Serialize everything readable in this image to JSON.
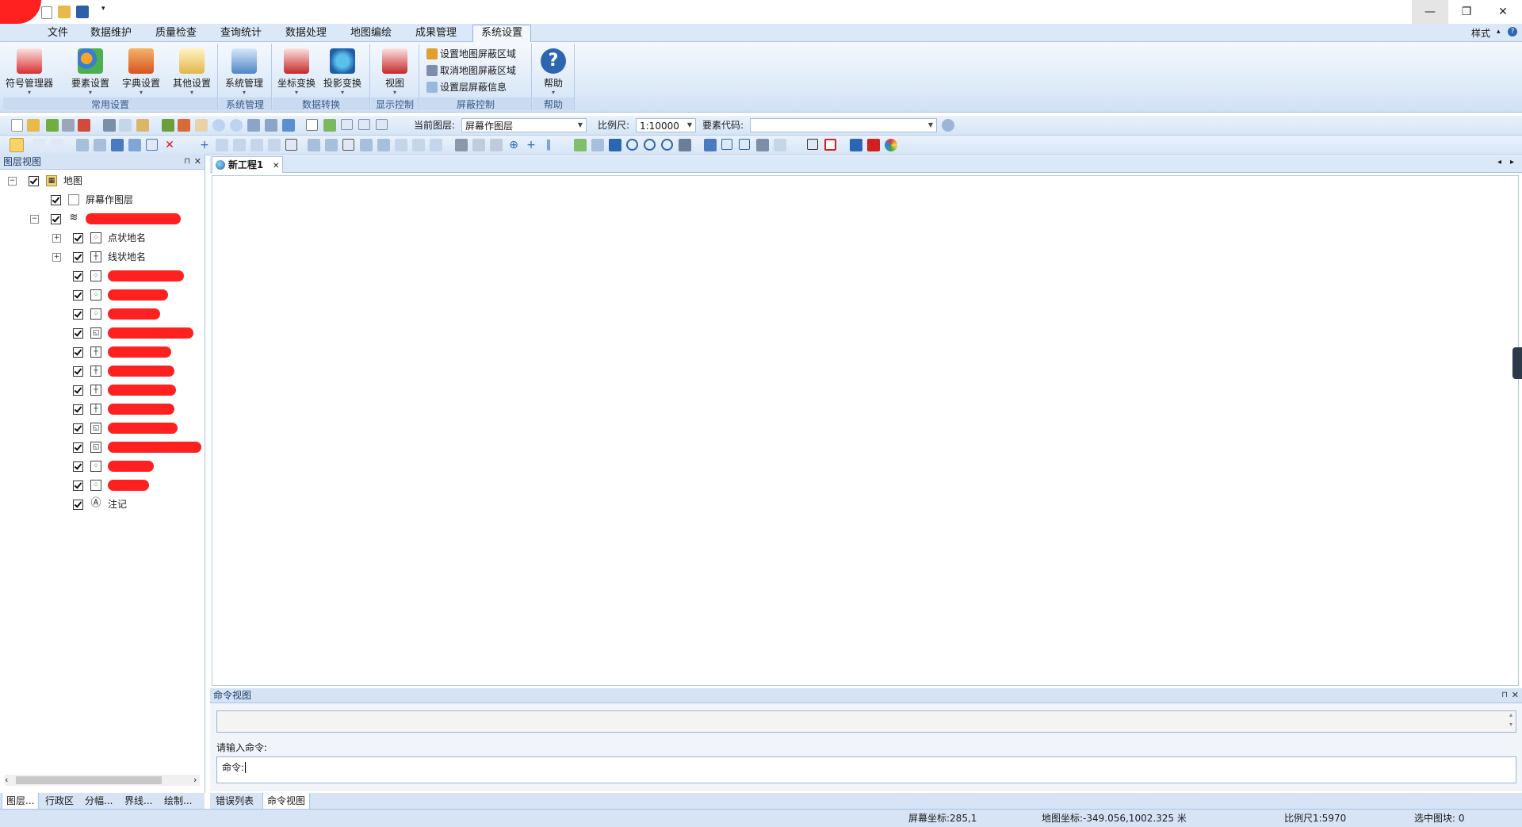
{
  "window": {
    "minimize": "—",
    "restore": "❐",
    "close": "✕"
  },
  "ribbon": {
    "tabs": [
      "文件",
      "数据维护",
      "质量检查",
      "查询统计",
      "数据处理",
      "地图编绘",
      "成果管理",
      "系统设置"
    ],
    "active_tab": "系统设置",
    "style_label": "样式",
    "groups": {
      "common": {
        "label": "常用设置",
        "buttons": [
          "符号管理器",
          "要素设置",
          "字典设置",
          "其他设置"
        ]
      },
      "system": {
        "label": "系统管理",
        "buttons": [
          "系统管理"
        ]
      },
      "convert": {
        "label": "数据转换",
        "buttons": [
          "坐标变换",
          "投影变换"
        ]
      },
      "display": {
        "label": "显示控制",
        "buttons": [
          "视图"
        ]
      },
      "mask": {
        "label": "屏蔽控制",
        "buttons": [
          "设置地图屏蔽区域",
          "取消地图屏蔽区域",
          "设置层屏蔽信息"
        ]
      },
      "help": {
        "label": "帮助",
        "buttons": [
          "帮助"
        ]
      }
    }
  },
  "toolbar1": {
    "current_layer_label": "当前图层:",
    "current_layer_value": "屏幕作图层",
    "scale_label": "比例尺:",
    "scale_value": "1:10000",
    "feature_code_label": "要素代码:",
    "feature_code_value": ""
  },
  "layer_panel": {
    "title": "图层视图",
    "tree": [
      {
        "label": "地图",
        "level": 0,
        "icon": "map"
      },
      {
        "label": "屏幕作图层",
        "level": 1,
        "icon": "page"
      },
      {
        "label": "",
        "level": 1,
        "icon": "layers",
        "redacted": true
      },
      {
        "label": "点状地名",
        "level": 2,
        "icon": "point"
      },
      {
        "label": "线状地名",
        "level": 2,
        "icon": "line"
      },
      {
        "label": "",
        "level": 2,
        "icon": "point",
        "redacted": true
      },
      {
        "label": "",
        "level": 2,
        "icon": "point",
        "redacted": true
      },
      {
        "label": "",
        "level": 2,
        "icon": "point",
        "redacted": true
      },
      {
        "label": "",
        "level": 2,
        "icon": "polygon",
        "redacted": true
      },
      {
        "label": "",
        "level": 2,
        "icon": "line",
        "redacted": true
      },
      {
        "label": "",
        "level": 2,
        "icon": "line",
        "redacted": true
      },
      {
        "label": "",
        "level": 2,
        "icon": "line",
        "redacted": true
      },
      {
        "label": "",
        "level": 2,
        "icon": "line",
        "redacted": true
      },
      {
        "label": "",
        "level": 2,
        "icon": "polygon",
        "redacted": true
      },
      {
        "label": "",
        "level": 2,
        "icon": "polygon",
        "redacted": true
      },
      {
        "label": "",
        "level": 2,
        "icon": "point",
        "redacted": true
      },
      {
        "label": "",
        "level": 2,
        "icon": "point",
        "redacted": true
      },
      {
        "label": "注记",
        "level": 2,
        "icon": "annotation"
      }
    ]
  },
  "bottom_tabs_left": [
    "图层...",
    "行政区",
    "分幅...",
    "界线...",
    "绘制..."
  ],
  "bottom_tabs_right": [
    "错误列表",
    "命令视图"
  ],
  "bottom_tabs_right_active": "命令视图",
  "document": {
    "tab_label": "新工程1"
  },
  "command_view": {
    "title": "命令视图",
    "prompt_label": "请输入命令:",
    "input_value": "命令:"
  },
  "status": {
    "screen_coord": "屏幕坐标:285,1",
    "map_coord": "地图坐标:-349.056,1002.325 米",
    "scale": "比例尺1:5970",
    "selected": "选中图块: 0"
  },
  "colors": {
    "ribbon_bg": "#dce9f8",
    "accent": "#2b66b1",
    "redaction": "#ff2020"
  }
}
